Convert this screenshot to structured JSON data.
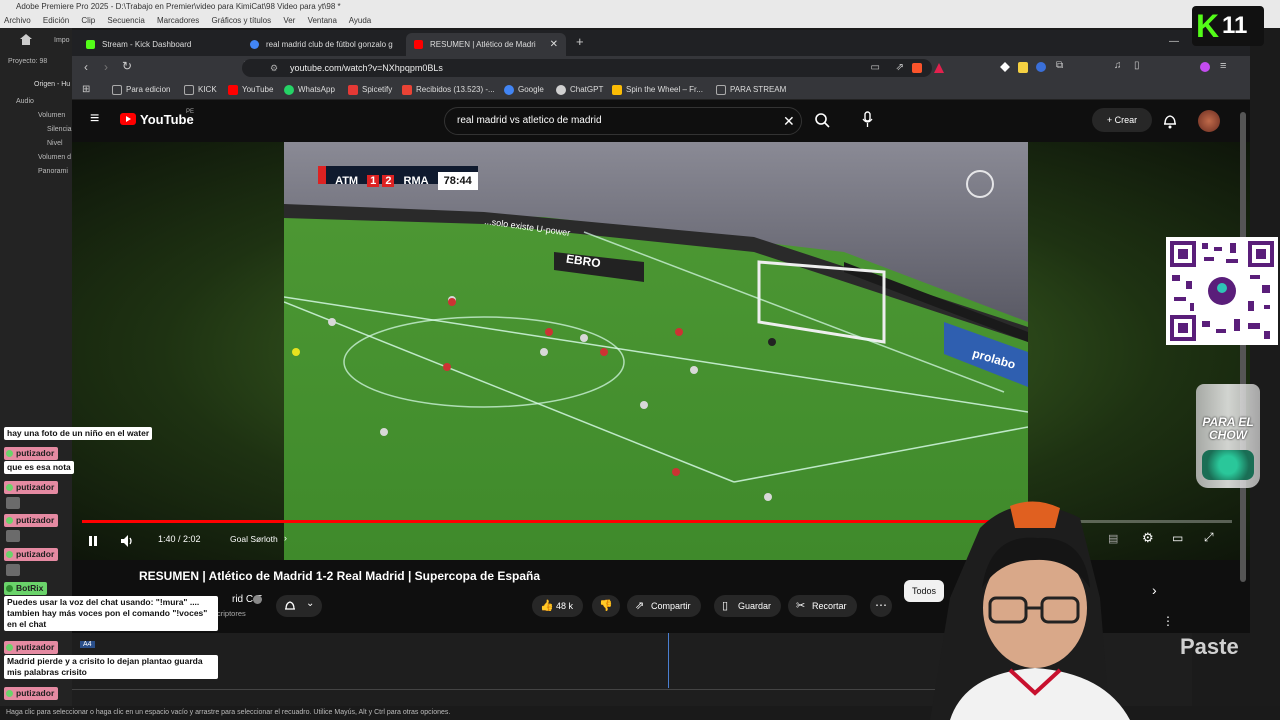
{
  "premiere": {
    "title": "Adobe Premiere Pro 2025 - D:\\Trabajo en Premier\\video para KimiCat\\98 Video para yt\\98 *",
    "menu": [
      "Archivo",
      "Edición",
      "Clip",
      "Secuencia",
      "Marcadores",
      "Gráficos y títulos",
      "Ver",
      "Ventana",
      "Ayuda"
    ],
    "project_label": "Proyecto: 98",
    "impo": "Impo",
    "origin_tab": "Origen - Hu",
    "tree": [
      "Audio",
      "Volumen",
      "Silencia",
      "Nivel",
      "Volumen d",
      "Panorami"
    ],
    "status_bar": "Haga clic para seleccionar o haga clic en un espacio vacío y arrastre para seleccionar el recuadro. Utilice Mayús, Alt y Ctrl para otras opciones.",
    "track_label": "A4"
  },
  "browser": {
    "tabs": [
      {
        "label": "Stream - Kick Dashboard",
        "color": "#53fc18"
      },
      {
        "label": "real madrid club de fútbol gonzalo g",
        "color": "#4285f4"
      },
      {
        "label": "RESUMEN | Atlético de Madri",
        "color": "#ff0000"
      }
    ],
    "new_tab": "+",
    "url": "youtube.com/watch?v=NXhpqpm0BLs",
    "bookmarks": [
      {
        "label": "Para edicion",
        "color": "#9aa0a6"
      },
      {
        "label": "KICK",
        "color": "#9aa0a6"
      },
      {
        "label": "YouTube",
        "color": "#ff0000"
      },
      {
        "label": "WhatsApp",
        "color": "#25d366"
      },
      {
        "label": "Spicetify",
        "color": "#e53935"
      },
      {
        "label": "Recibidos (13.523) -...",
        "color": "#ea4335"
      },
      {
        "label": "Google",
        "color": "#4285f4"
      },
      {
        "label": "ChatGPT",
        "color": "#d0d0d0"
      },
      {
        "label": "Spin the Wheel – Fr...",
        "color": "#fbbc05"
      },
      {
        "label": "PARA STREAM",
        "color": "#9aa0a6"
      }
    ]
  },
  "youtube": {
    "logo": "YouTube",
    "logo_region": "PE",
    "search_query": "real madrid vs atletico de madrid",
    "create_label": "Crear",
    "player": {
      "score_home": "ATM",
      "score_home_goals": "1",
      "score_away_goals": "2",
      "score_away": "RMA",
      "clock": "78:44",
      "time": "1:40 / 2:02",
      "chapter": "Goal Sørloth",
      "progress_fraction": 0.81,
      "stadium_text": "...solo existe U-power",
      "ad_board": "EBRO",
      "ad_prolabo": "prolabo"
    },
    "title": "RESUMEN | Atlético de Madrid 1-2 Real Madrid | Supercopa de España",
    "channel_name": "rid C.F",
    "channel_subs": "criptores",
    "likes": "48 k",
    "share_label": "Compartir",
    "save_label": "Guardar",
    "clip_label": "Recortar",
    "filter_chip": "Todos"
  },
  "overlays": {
    "k_logo": "K",
    "k_number": "11",
    "jar_text": "PARA EL CHOW",
    "paste_label": "Paste"
  },
  "chat": [
    {
      "type": "msg",
      "text": "hay una foto de un niño en el water"
    },
    {
      "type": "user",
      "text": "putizador"
    },
    {
      "type": "msg",
      "text": "que es esa nota"
    },
    {
      "type": "user",
      "text": "putizador"
    },
    {
      "type": "user",
      "text": "putizador"
    },
    {
      "type": "user",
      "text": "putizador"
    },
    {
      "type": "user",
      "text": "BotRix"
    },
    {
      "type": "msg",
      "text": "Puedes usar la voz del chat usando: \"!mura\" .... tambien hay más voces pon el comando \"!voces\" en el chat"
    },
    {
      "type": "user",
      "text": "putizador"
    },
    {
      "type": "msg",
      "text": "Madrid pierde y a crisito lo dejan plantao guarda mis palabras crisito"
    },
    {
      "type": "user",
      "text": "putizador"
    }
  ]
}
